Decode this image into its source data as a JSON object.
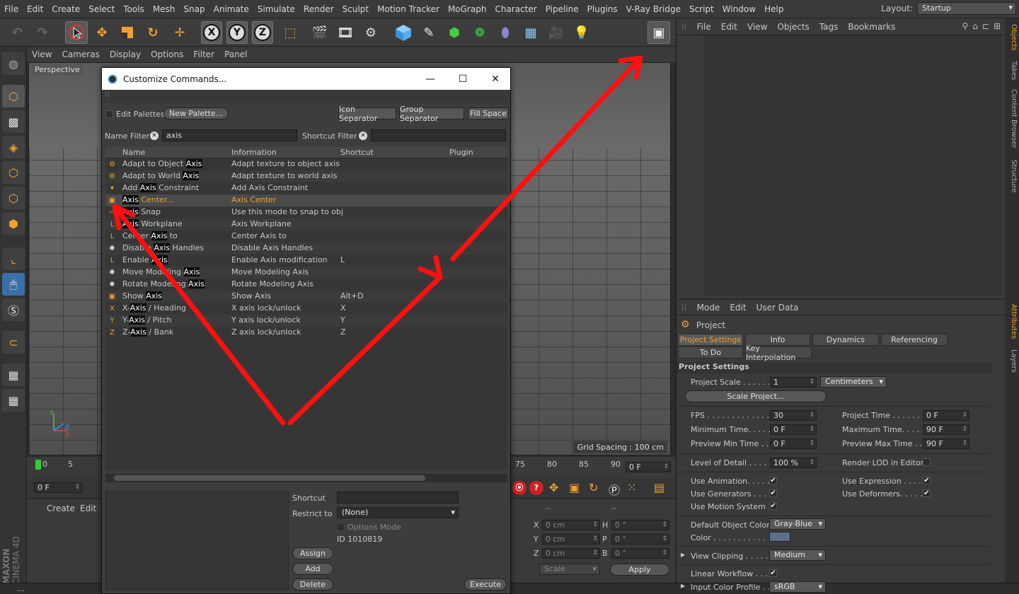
{
  "menubar": {
    "items": [
      "File",
      "Edit",
      "Create",
      "Select",
      "Tools",
      "Mesh",
      "Snap",
      "Animate",
      "Simulate",
      "Render",
      "Sculpt",
      "Motion Tracker",
      "MoGraph",
      "Character",
      "Pipeline",
      "Plugins",
      "V-Ray Bridge",
      "Script",
      "Window",
      "Help"
    ],
    "layout_label": "Layout:",
    "layout_value": "Startup"
  },
  "viewport": {
    "menu": [
      "View",
      "Cameras",
      "Display",
      "Options",
      "Filter",
      "Panel"
    ],
    "camera_label": "Perspective",
    "grid_spacing": "Grid Spacing : 100 cm"
  },
  "timeline": {
    "ticks_left": [
      "0",
      "5"
    ],
    "ticks_right": [
      "75",
      "80",
      "85",
      "90"
    ],
    "end_frame": "0 F",
    "current_frame": "0 F"
  },
  "bottom_panel": {
    "menu": [
      "Create",
      "Edit"
    ],
    "coords": [
      {
        "axis": "X",
        "value": "0 cm",
        "rot_axis": "H",
        "rot_value": "0 °"
      },
      {
        "axis": "Y",
        "value": "0 cm",
        "rot_axis": "P",
        "rot_value": "0 °"
      },
      {
        "axis": "Z",
        "value": "0 cm",
        "rot_axis": "B",
        "rot_value": "0 °"
      }
    ],
    "col_dashes": [
      "--",
      "--"
    ],
    "scale_value": "Scale",
    "apply_label": "Apply"
  },
  "object_manager": {
    "menu": [
      "File",
      "Edit",
      "View",
      "Objects",
      "Tags",
      "Bookmarks"
    ]
  },
  "right_tabs": [
    "Objects",
    "Takes",
    "Content Browser",
    "Structure",
    "Attributes",
    "Layers"
  ],
  "attributes": {
    "menu": [
      "Mode",
      "Edit",
      "User Data"
    ],
    "object_name": "Project",
    "tabs_row1": [
      "Project Settings",
      "Info",
      "Dynamics",
      "Referencing"
    ],
    "tabs_row2": [
      "To Do",
      "Key Interpolation"
    ],
    "section_title": "Project Settings",
    "project_scale_label": "Project Scale . . . . . .",
    "project_scale_value": "1",
    "project_scale_unit": "Centimeters",
    "scale_project_btn": "Scale Project...",
    "fps_label": "FPS . . . . . . . . . . . . . .",
    "fps_value": "30",
    "project_time_label": "Project Time . . . . . . . .",
    "project_time_value": "0 F",
    "min_time_label": "Minimum Time. . . . .",
    "min_time_value": "0 F",
    "max_time_label": "Maximum Time. . . . . .",
    "max_time_value": "90 F",
    "prev_min_label": "Preview Min Time . .",
    "prev_min_value": "0 F",
    "prev_max_label": "Preview Max Time . . .",
    "prev_max_value": "90 F",
    "lod_label": "Level of Detail . . . . .",
    "lod_value": "100 %",
    "render_lod_label": "Render LOD in Editor",
    "use_animation_label": "Use Animation. . . . . .",
    "use_expression_label": "Use Expression . . . . .",
    "use_generators_label": "Use Generators . . . .",
    "use_deformers_label": "Use Deformers. . . . .",
    "use_motion_label": "Use Motion System",
    "check_mark": "✔",
    "default_color_label": "Default Object Color",
    "default_color_value": "Gray-Blue",
    "color_label": "Color . . . . . . . . . . .",
    "view_clipping_label": "View Clipping . . . . .",
    "view_clipping_value": "Medium",
    "linear_workflow_label": "Linear Workflow . . .",
    "input_profile_label": "Input Color Profile . .",
    "input_profile_value": "sRGB"
  },
  "dialog": {
    "title": "Customize Commands...",
    "edit_palettes": "Edit Palettes",
    "new_palette": "New Palette...",
    "icon_separator": "Icon Separator",
    "group_separator": "Group Separator",
    "fill_space": "Fill Space",
    "name_filter_label": "Name Filter",
    "name_filter_value": "axis",
    "shortcut_filter_label": "Shortcut Filter",
    "columns": [
      "Name",
      "Information",
      "Shortcut",
      "Plugin"
    ],
    "rows": [
      {
        "pre": "Adapt to Object ",
        "hl": "Axis",
        "post": "",
        "info": "Adapt texture to object axis",
        "shortcut": "",
        "icon": "⚙"
      },
      {
        "pre": "Adapt to World ",
        "hl": "Axis",
        "post": "",
        "info": "Adapt texture to world axis",
        "shortcut": "",
        "icon": "⚙"
      },
      {
        "pre": "Add ",
        "hl": "Axis",
        "post": " Constraint",
        "info": "Add Axis Constraint",
        "shortcut": "",
        "icon": "✦"
      },
      {
        "pre": "",
        "hl": "Axis",
        "post": " Center...",
        "info": "Axis Center",
        "shortcut": "",
        "icon": "▣"
      },
      {
        "pre": "",
        "hl": "Axis",
        "post": " Snap",
        "info": "Use this mode to snap to obj",
        "shortcut": "",
        "icon": "⌐"
      },
      {
        "pre": "",
        "hl": "Axis",
        "post": " Workplane",
        "info": "Axis Workplane",
        "shortcut": "",
        "icon": "L"
      },
      {
        "pre": "Center ",
        "hl": "Axis",
        "post": " to",
        "info": "Center Axis to",
        "shortcut": "",
        "icon": "L"
      },
      {
        "pre": "Disable ",
        "hl": "Axis",
        "post": " Handles",
        "info": "Disable Axis Handles",
        "shortcut": "",
        "icon": "✺"
      },
      {
        "pre": "Enable ",
        "hl": "Axis",
        "post": "",
        "info": "Enable Axis modification",
        "shortcut": "L",
        "icon": "L"
      },
      {
        "pre": "Move Modeling ",
        "hl": "Axis",
        "post": "",
        "info": "Move Modeling Axis",
        "shortcut": "",
        "icon": "✺"
      },
      {
        "pre": "Rotate Modeling ",
        "hl": "Axis",
        "post": "",
        "info": "Rotate Modeling Axis",
        "shortcut": "",
        "icon": "✺"
      },
      {
        "pre": "Show ",
        "hl": "Axis",
        "post": "",
        "info": "Show Axis",
        "shortcut": "Alt+D",
        "icon": "▣"
      },
      {
        "pre": "X-",
        "hl": "Axis",
        "post": " / Heading",
        "info": "X axis lock/unlock",
        "shortcut": "X",
        "icon": "X"
      },
      {
        "pre": "Y-",
        "hl": "Axis",
        "post": " / Pitch",
        "info": "Y axis lock/unlock",
        "shortcut": "Y",
        "icon": "Y"
      },
      {
        "pre": "Z-",
        "hl": "Axis",
        "post": " / Bank",
        "info": "Z axis lock/unlock",
        "shortcut": "Z",
        "icon": "Z"
      }
    ],
    "shortcut_label": "Shortcut",
    "restrict_label": "Restrict to",
    "restrict_value": "(None)",
    "options_mode": "Options Mode",
    "id_text": "ID 1010819",
    "assign": "Assign",
    "add": "Add",
    "delete": "Delete",
    "execute": "Execute"
  },
  "brand": {
    "line1": "MAXON",
    "line2": "CINEMA 4D"
  },
  "status": "..."
}
